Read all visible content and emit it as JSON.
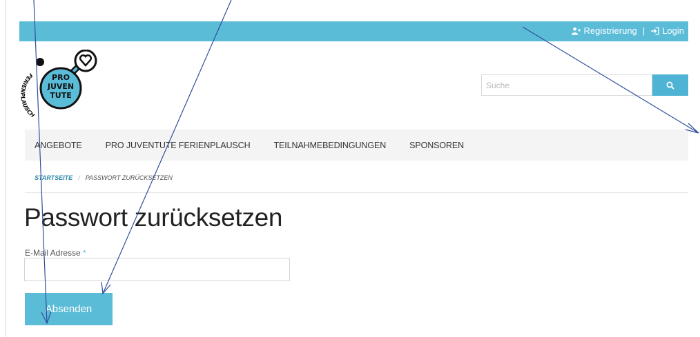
{
  "topbar": {
    "register_label": "Registrierung",
    "separator": "|",
    "login_label": "Login"
  },
  "logo": {
    "line1": "PRO",
    "line2": "JUVEN",
    "line3": "TUTE",
    "arc_text": "FERIENPLAUSCH"
  },
  "search": {
    "placeholder": "Suche"
  },
  "nav": {
    "items": [
      "ANGEBOTE",
      "PRO JUVENTUTE FERIENPLAUSCH",
      "TEILNAHMEBEDINGUNGEN",
      "SPONSOREN"
    ]
  },
  "breadcrumb": {
    "home": "STARTSEITE",
    "separator": "/",
    "current": "PASSWORT ZURÜCKSETZEN"
  },
  "page": {
    "title": "Passwort zurücksetzen",
    "email_label": "E-Mail Adresse",
    "required_mark": "*",
    "email_value": "",
    "submit_label": "Absenden"
  },
  "colors": {
    "accent": "#5bbcd8",
    "accent_dark": "#4fb3d4",
    "annotation": "#2f4f9a"
  }
}
